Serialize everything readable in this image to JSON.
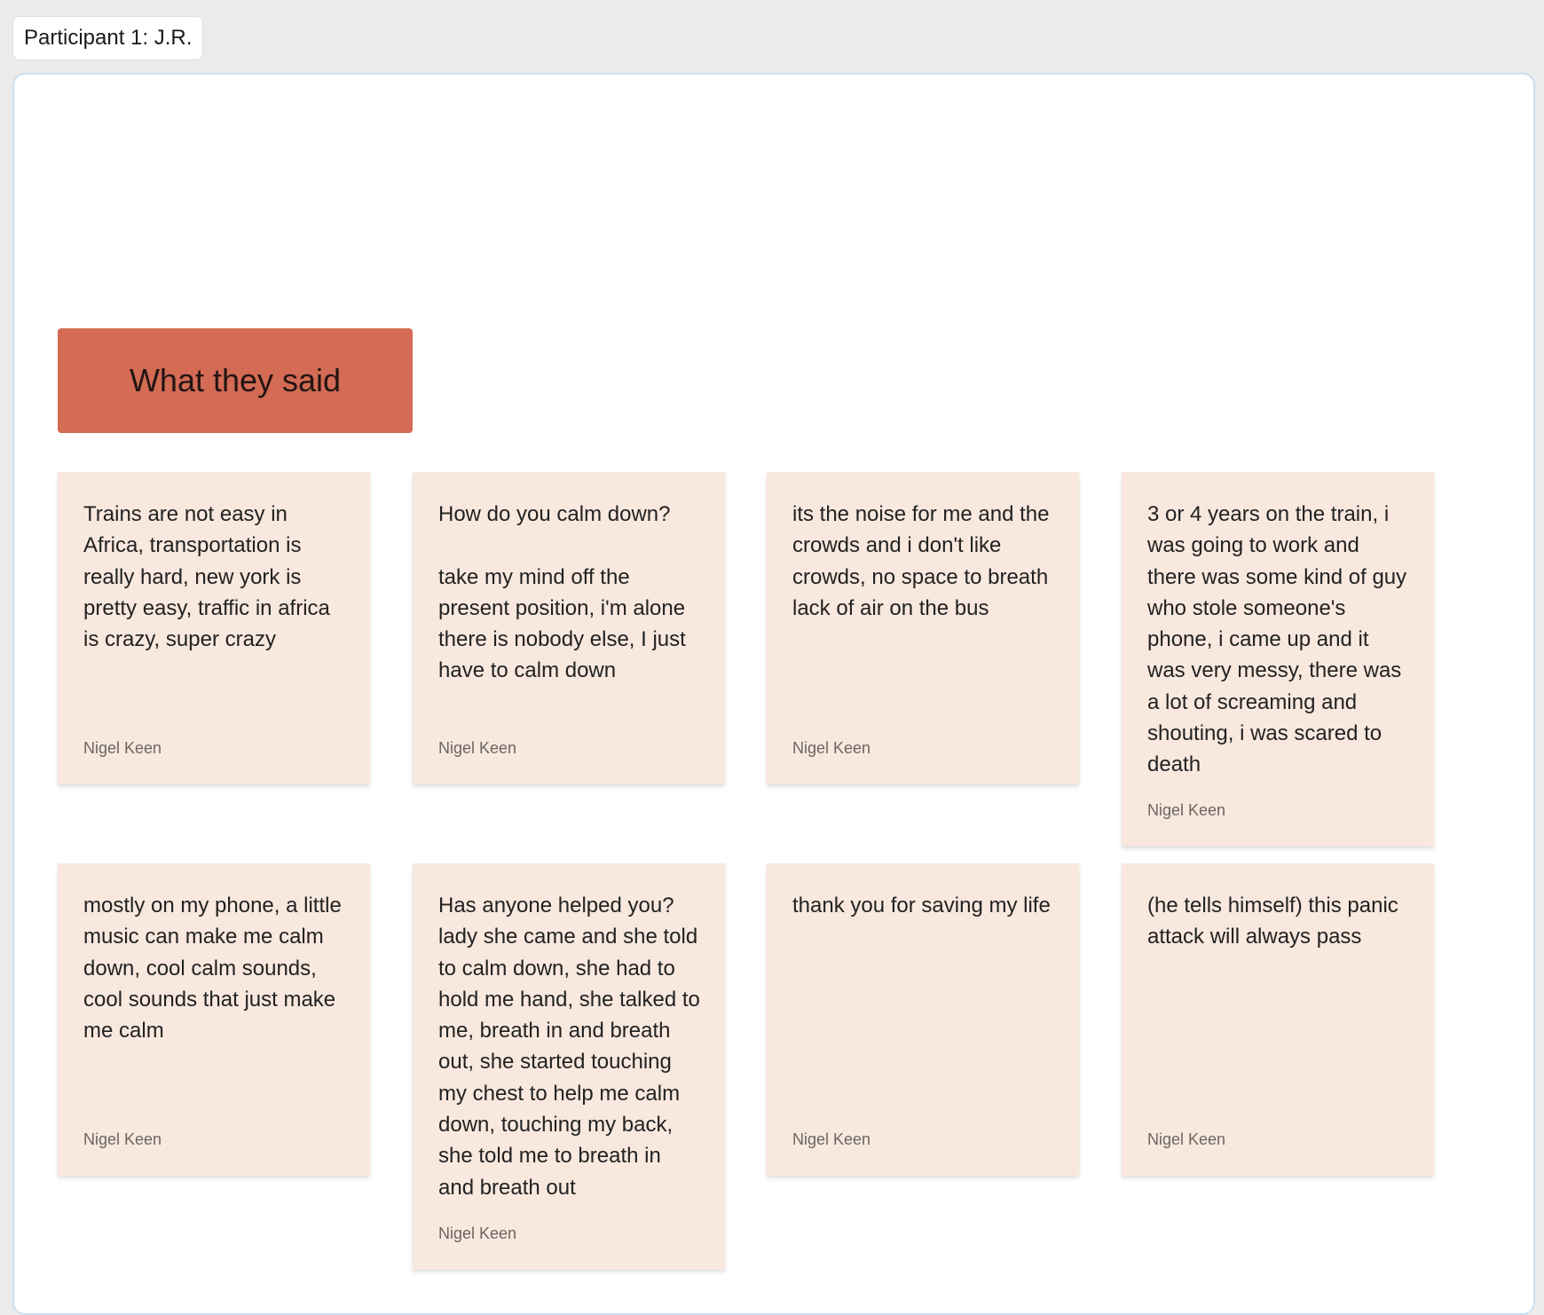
{
  "frame": {
    "label": "Participant 1: J.R."
  },
  "section": {
    "title": "What they said"
  },
  "notes": [
    {
      "text": "Trains are not easy in Africa, transportation is really hard, new york is pretty easy, traffic in africa is crazy, super crazy",
      "author": "Nigel Keen"
    },
    {
      "text": "How do you calm down?\n\ntake my mind off the present position, i'm alone there is nobody else, I just have to calm down",
      "author": "Nigel Keen"
    },
    {
      "text": "its the noise for me and the crowds and i don't like crowds, no space to breath lack of air on the bus",
      "author": "Nigel Keen"
    },
    {
      "text": "3 or 4 years on the train, i was going to work and there was some kind of guy who stole someone's phone, i came up and it was very messy, there was a lot of screaming and shouting, i was scared to death",
      "author": "Nigel Keen"
    },
    {
      "text": "mostly on my phone, a little music can make me calm down, cool calm sounds, cool sounds that just make me calm",
      "author": "Nigel Keen"
    },
    {
      "text": "Has anyone helped you? lady she came and she told to calm down, she had to hold me hand, she talked to me, breath in and breath out, she started touching my chest to help me calm down, touching my back, she told me to breath in and breath out",
      "author": "Nigel Keen"
    },
    {
      "text": "thank you for saving my life",
      "author": "Nigel Keen"
    },
    {
      "text": "(he tells himself) this panic attack will always pass",
      "author": "Nigel Keen"
    }
  ]
}
